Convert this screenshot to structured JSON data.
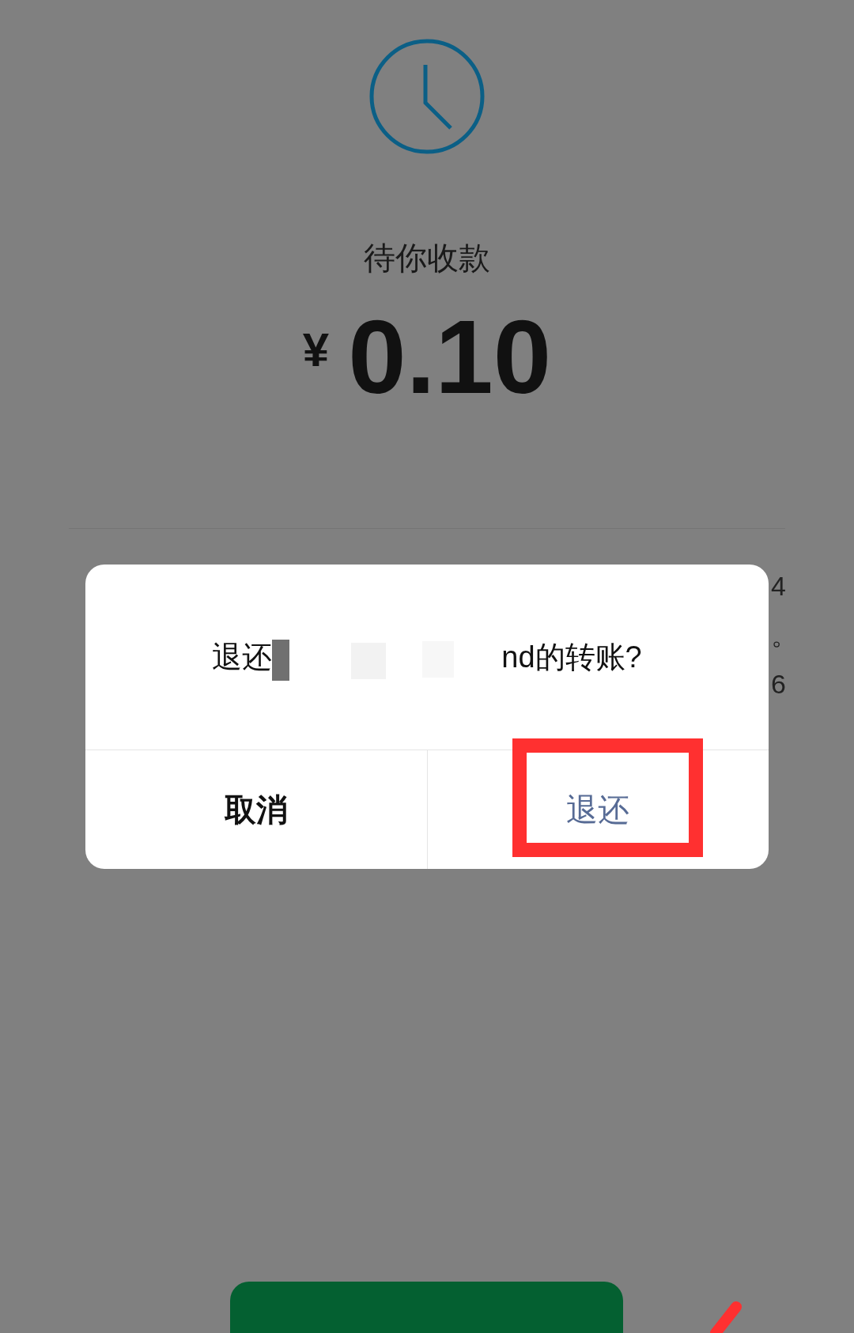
{
  "status": {
    "title": "待你收款",
    "currency": "¥",
    "amount": "0.10"
  },
  "rows": [
    {
      "value": "4"
    },
    {
      "value": "。"
    },
    {
      "value": "6"
    }
  ],
  "dialog": {
    "title_prefix": "退还",
    "title_suffix": "nd的转账?",
    "buttons": [
      {
        "label": "取消",
        "kind": "cancel",
        "highlighted": false
      },
      {
        "label": "退还",
        "kind": "confirm",
        "highlighted": true
      }
    ]
  },
  "primary_button": {
    "kind": "primary"
  }
}
